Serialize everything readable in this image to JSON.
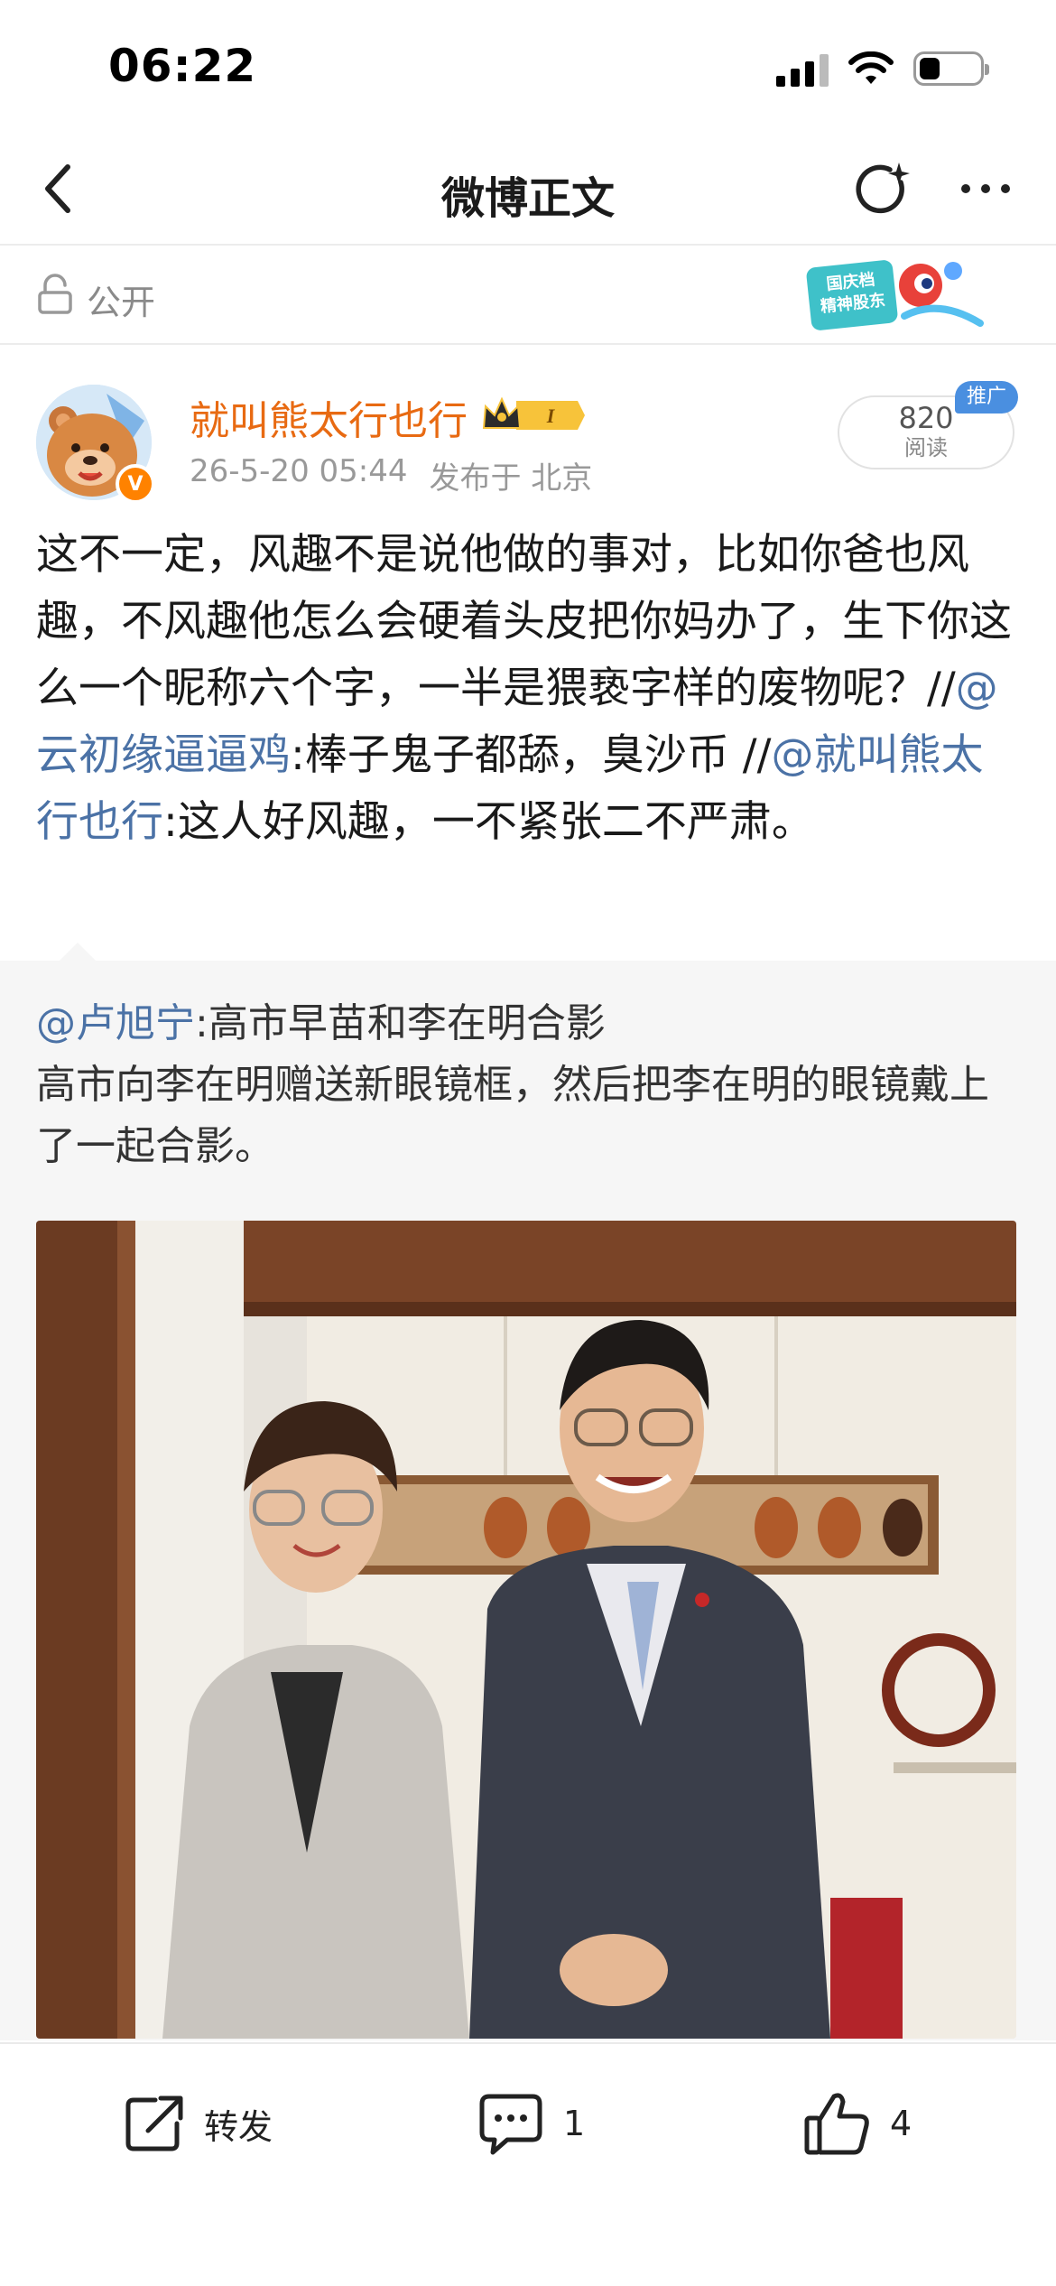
{
  "status_bar": {
    "time": "06:22",
    "icons": [
      "cellular-signal-icon",
      "wifi-icon",
      "battery-icon"
    ],
    "battery_level": 0.35
  },
  "nav": {
    "title": "微博正文",
    "back_icon": "chevron-left-icon",
    "refresh_icon": "refresh-icon",
    "more_icon": "more-icon"
  },
  "visibility": {
    "label": "公开",
    "icon": "lock-icon",
    "promo_text": "国庆档精神股东"
  },
  "post": {
    "username": "就叫熊太行也行",
    "vip_level": "I",
    "timestamp": "26-5-20 05:44",
    "location": "发布于 北京",
    "read_count": "820",
    "read_label": "阅读",
    "ad_tag": "推广",
    "text_part1": "这不一定，风趣不是说他做的事对，比如你爸也风趣，不风趣他怎么会硬着头皮把你妈办了，生下你这么一个昵称六个字，一半是猥亵字样的废物呢？//",
    "mention1": "@云初缘逼逼鸡",
    "text_part2": ":棒子鬼子都舔，臭沙币 //",
    "mention2": "@就叫熊太行也行",
    "text_part3": ":这人好风趣，一不紧张二不严肃。"
  },
  "retweet": {
    "author_mention": "@卢旭宁",
    "title_text": ":高市早苗和李在明合影",
    "body": "高市向李在明赠送新眼镜框，然后把李在明的眼镜戴上了一起合影。"
  },
  "actions": {
    "repost_label": "转发",
    "comment_count": "1",
    "like_count": "4"
  },
  "colors": {
    "username": "#e86a12",
    "mention": "#4b72a6",
    "ad_tag": "#4a8fe0",
    "retweet_bg": "#f6f6f6"
  }
}
